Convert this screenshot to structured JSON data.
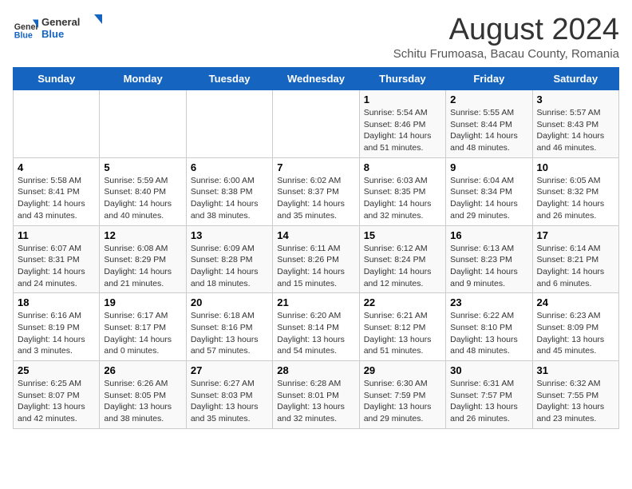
{
  "header": {
    "logo_general": "General",
    "logo_blue": "Blue",
    "month_title": "August 2024",
    "subtitle": "Schitu Frumoasa, Bacau County, Romania"
  },
  "weekdays": [
    "Sunday",
    "Monday",
    "Tuesday",
    "Wednesday",
    "Thursday",
    "Friday",
    "Saturday"
  ],
  "weeks": [
    [
      {
        "day": "",
        "info": ""
      },
      {
        "day": "",
        "info": ""
      },
      {
        "day": "",
        "info": ""
      },
      {
        "day": "",
        "info": ""
      },
      {
        "day": "1",
        "info": "Sunrise: 5:54 AM\nSunset: 8:46 PM\nDaylight: 14 hours and 51 minutes."
      },
      {
        "day": "2",
        "info": "Sunrise: 5:55 AM\nSunset: 8:44 PM\nDaylight: 14 hours and 48 minutes."
      },
      {
        "day": "3",
        "info": "Sunrise: 5:57 AM\nSunset: 8:43 PM\nDaylight: 14 hours and 46 minutes."
      }
    ],
    [
      {
        "day": "4",
        "info": "Sunrise: 5:58 AM\nSunset: 8:41 PM\nDaylight: 14 hours and 43 minutes."
      },
      {
        "day": "5",
        "info": "Sunrise: 5:59 AM\nSunset: 8:40 PM\nDaylight: 14 hours and 40 minutes."
      },
      {
        "day": "6",
        "info": "Sunrise: 6:00 AM\nSunset: 8:38 PM\nDaylight: 14 hours and 38 minutes."
      },
      {
        "day": "7",
        "info": "Sunrise: 6:02 AM\nSunset: 8:37 PM\nDaylight: 14 hours and 35 minutes."
      },
      {
        "day": "8",
        "info": "Sunrise: 6:03 AM\nSunset: 8:35 PM\nDaylight: 14 hours and 32 minutes."
      },
      {
        "day": "9",
        "info": "Sunrise: 6:04 AM\nSunset: 8:34 PM\nDaylight: 14 hours and 29 minutes."
      },
      {
        "day": "10",
        "info": "Sunrise: 6:05 AM\nSunset: 8:32 PM\nDaylight: 14 hours and 26 minutes."
      }
    ],
    [
      {
        "day": "11",
        "info": "Sunrise: 6:07 AM\nSunset: 8:31 PM\nDaylight: 14 hours and 24 minutes."
      },
      {
        "day": "12",
        "info": "Sunrise: 6:08 AM\nSunset: 8:29 PM\nDaylight: 14 hours and 21 minutes."
      },
      {
        "day": "13",
        "info": "Sunrise: 6:09 AM\nSunset: 8:28 PM\nDaylight: 14 hours and 18 minutes."
      },
      {
        "day": "14",
        "info": "Sunrise: 6:11 AM\nSunset: 8:26 PM\nDaylight: 14 hours and 15 minutes."
      },
      {
        "day": "15",
        "info": "Sunrise: 6:12 AM\nSunset: 8:24 PM\nDaylight: 14 hours and 12 minutes."
      },
      {
        "day": "16",
        "info": "Sunrise: 6:13 AM\nSunset: 8:23 PM\nDaylight: 14 hours and 9 minutes."
      },
      {
        "day": "17",
        "info": "Sunrise: 6:14 AM\nSunset: 8:21 PM\nDaylight: 14 hours and 6 minutes."
      }
    ],
    [
      {
        "day": "18",
        "info": "Sunrise: 6:16 AM\nSunset: 8:19 PM\nDaylight: 14 hours and 3 minutes."
      },
      {
        "day": "19",
        "info": "Sunrise: 6:17 AM\nSunset: 8:17 PM\nDaylight: 14 hours and 0 minutes."
      },
      {
        "day": "20",
        "info": "Sunrise: 6:18 AM\nSunset: 8:16 PM\nDaylight: 13 hours and 57 minutes."
      },
      {
        "day": "21",
        "info": "Sunrise: 6:20 AM\nSunset: 8:14 PM\nDaylight: 13 hours and 54 minutes."
      },
      {
        "day": "22",
        "info": "Sunrise: 6:21 AM\nSunset: 8:12 PM\nDaylight: 13 hours and 51 minutes."
      },
      {
        "day": "23",
        "info": "Sunrise: 6:22 AM\nSunset: 8:10 PM\nDaylight: 13 hours and 48 minutes."
      },
      {
        "day": "24",
        "info": "Sunrise: 6:23 AM\nSunset: 8:09 PM\nDaylight: 13 hours and 45 minutes."
      }
    ],
    [
      {
        "day": "25",
        "info": "Sunrise: 6:25 AM\nSunset: 8:07 PM\nDaylight: 13 hours and 42 minutes."
      },
      {
        "day": "26",
        "info": "Sunrise: 6:26 AM\nSunset: 8:05 PM\nDaylight: 13 hours and 38 minutes."
      },
      {
        "day": "27",
        "info": "Sunrise: 6:27 AM\nSunset: 8:03 PM\nDaylight: 13 hours and 35 minutes."
      },
      {
        "day": "28",
        "info": "Sunrise: 6:28 AM\nSunset: 8:01 PM\nDaylight: 13 hours and 32 minutes."
      },
      {
        "day": "29",
        "info": "Sunrise: 6:30 AM\nSunset: 7:59 PM\nDaylight: 13 hours and 29 minutes."
      },
      {
        "day": "30",
        "info": "Sunrise: 6:31 AM\nSunset: 7:57 PM\nDaylight: 13 hours and 26 minutes."
      },
      {
        "day": "31",
        "info": "Sunrise: 6:32 AM\nSunset: 7:55 PM\nDaylight: 13 hours and 23 minutes."
      }
    ]
  ]
}
